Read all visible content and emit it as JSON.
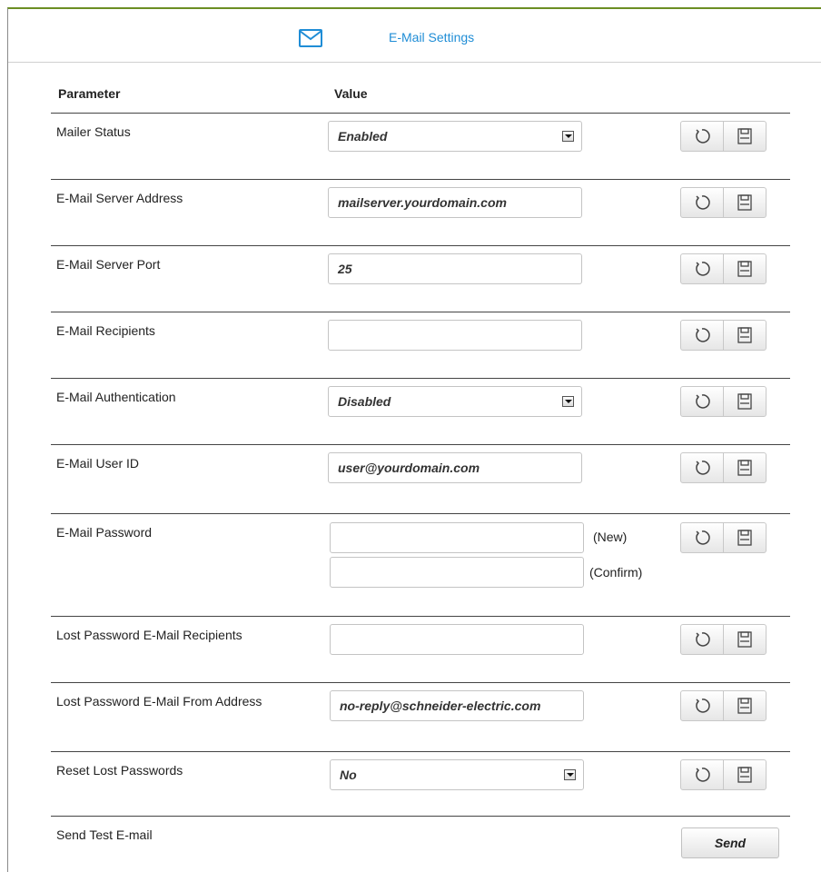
{
  "header": {
    "title": "E-Mail Settings",
    "icon": "mail-icon"
  },
  "columns": {
    "parameter": "Parameter",
    "value": "Value"
  },
  "rows": {
    "mailer_status": {
      "label": "Mailer Status",
      "value": "Enabled"
    },
    "server_address": {
      "label": "E-Mail Server Address",
      "value": "mailserver.yourdomain.com"
    },
    "server_port": {
      "label": "E-Mail Server Port",
      "value": "25"
    },
    "recipients": {
      "label": "E-Mail Recipients",
      "value": ""
    },
    "authentication": {
      "label": "E-Mail Authentication",
      "value": "Disabled"
    },
    "user_id": {
      "label": "E-Mail User ID",
      "value": "user@yourdomain.com"
    },
    "password": {
      "label": "E-Mail Password",
      "new_value": "",
      "confirm_value": "",
      "new_suffix": "(New)",
      "confirm_suffix": "(Confirm)"
    },
    "lost_recipients": {
      "label": "Lost Password E-Mail Recipients",
      "value": ""
    },
    "lost_from": {
      "label": "Lost Password E-Mail From Address",
      "value": "no-reply@schneider-electric.com"
    },
    "reset_lost": {
      "label": "Reset Lost Passwords",
      "value": "No"
    },
    "send_test": {
      "label": "Send Test E-mail",
      "button": "Send"
    }
  },
  "colors": {
    "accent": "#1f8dd6",
    "frame_top": "#6b8e23"
  }
}
